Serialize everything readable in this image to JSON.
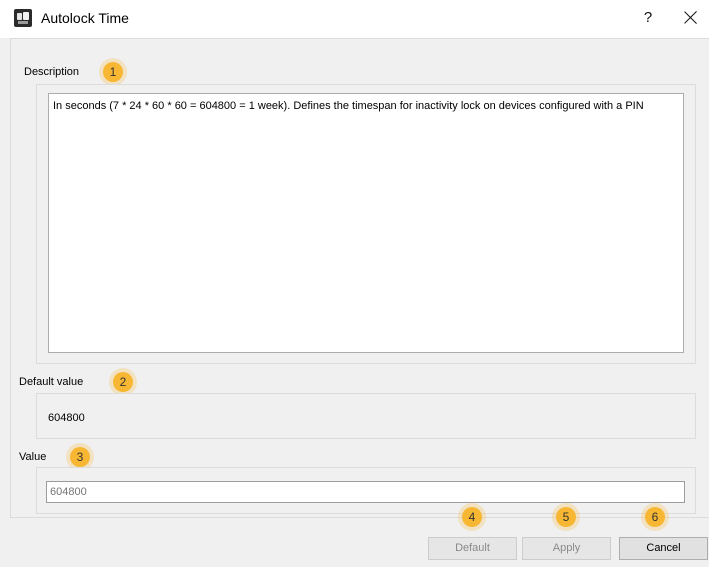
{
  "window": {
    "title": "Autolock Time",
    "help_label": "?",
    "app_icon": "app-icon"
  },
  "description": {
    "label": "Description",
    "text": "In seconds (7 * 24 * 60 * 60 = 604800 = 1 week). Defines the timespan for inactivity lock on devices configured with a PIN"
  },
  "default_value": {
    "label": "Default value",
    "value": "604800"
  },
  "value": {
    "label": "Value",
    "placeholder": "604800"
  },
  "buttons": {
    "default_label": "Default",
    "apply_label": "Apply",
    "cancel_label": "Cancel"
  },
  "badges": [
    "1",
    "2",
    "3",
    "4",
    "5",
    "6"
  ],
  "colors": {
    "badge": "#f7b733",
    "dialog_bg": "#f0f0f0"
  }
}
